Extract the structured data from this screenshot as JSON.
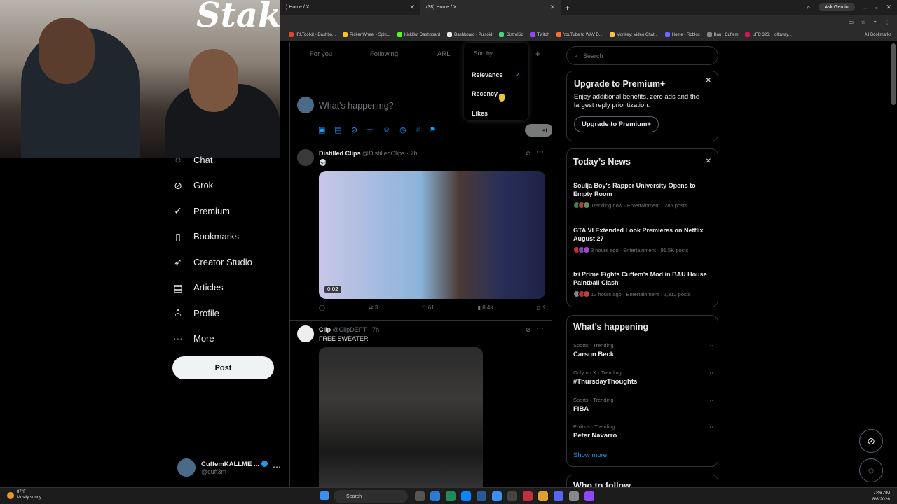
{
  "browser": {
    "tabs": [
      {
        "title": ") Home / X",
        "active": false
      },
      {
        "title": "(38) Home / X",
        "active": true
      }
    ],
    "new_tab": "+",
    "ask_gemini": "Ask Gemini",
    "bookmarks": [
      {
        "label": "IRLToolkit • Dashbo...",
        "color": "#e0452c"
      },
      {
        "label": "Picker Wheel - Spin...",
        "color": "#f2c230"
      },
      {
        "label": "KickBot Dashboard",
        "color": "#53fc18"
      },
      {
        "label": "Dashboard - Pulsoid",
        "color": "#e9e9e9"
      },
      {
        "label": "DistroKid",
        "color": "#3ddc84"
      },
      {
        "label": "Twitch",
        "color": "#9146ff"
      },
      {
        "label": "YouTube to WAV D...",
        "color": "#ff6b2c"
      },
      {
        "label": "Monkey: Video Chat...",
        "color": "#f5c542"
      },
      {
        "label": "Home - Roblox",
        "color": "#6b6bff"
      },
      {
        "label": "Bau | Cuffem",
        "color": "#888888"
      },
      {
        "label": "UFC 326: Holloway...",
        "color": "#d4145a"
      }
    ],
    "all_bookmarks": "All Bookmarks"
  },
  "nav": {
    "items": [
      {
        "label": "Chat",
        "icon": "chat-icon",
        "glyph": "◌"
      },
      {
        "label": "Grok",
        "icon": "grok-icon",
        "glyph": "⊘"
      },
      {
        "label": "Premium",
        "icon": "premium-icon",
        "glyph": "✓"
      },
      {
        "label": "Bookmarks",
        "icon": "bookmark-icon",
        "glyph": "▯"
      },
      {
        "label": "Creator Studio",
        "icon": "rocket-icon",
        "glyph": "➶"
      },
      {
        "label": "Articles",
        "icon": "articles-icon",
        "glyph": "▤"
      },
      {
        "label": "Profile",
        "icon": "profile-icon",
        "glyph": "♙"
      },
      {
        "label": "More",
        "icon": "more-icon",
        "glyph": "⋯"
      }
    ],
    "post_label": "Post",
    "account": {
      "name": "CuffemKALLME ...",
      "handle": "@cuff3m"
    }
  },
  "timeline": {
    "tabs": [
      "For you",
      "Following",
      "ARL"
    ],
    "compose_placeholder": "What's happening?",
    "post_button": "st",
    "sort_menu": {
      "title": "Sort by",
      "options": [
        "Relevance",
        "Recency",
        "Likes"
      ],
      "selected": "Relevance"
    },
    "tweets": [
      {
        "name": "Distilled Clips",
        "handle": "@DistilledClips · 7h",
        "text": "💀",
        "video_time": "0:02",
        "reposts": "3",
        "likes": "61",
        "views": "8.4K"
      },
      {
        "name": "Clip",
        "handle": "@ClipDEPT · 7h",
        "text": "FREE SWEATER"
      }
    ]
  },
  "right": {
    "search_placeholder": "Search",
    "premium": {
      "title": "Upgrade to Premium+",
      "desc": "Enjoy additional benefits, zero ads and the largest reply prioritization.",
      "button": "Upgrade to Premium+"
    },
    "news": {
      "title": "Today’s News",
      "items": [
        {
          "title": "Soulja Boy's Rapper University Opens to Empty Room",
          "meta": "Trending now · Entertainment · 285 posts"
        },
        {
          "title": "GTA VI Extended Look Premieres on Netflix August 27",
          "meta": "3 hours ago · Entertainment · 91.5K posts"
        },
        {
          "title": "Izi Prime Fights Cuffem's Mod in BAU House Paintball Clash",
          "meta": "12 hours ago · Entertainment · 2,312 posts"
        }
      ]
    },
    "happening": {
      "title": "What’s happening",
      "items": [
        {
          "cat": "Sports · Trending",
          "name": "Carson Beck"
        },
        {
          "cat": "Only on X · Trending",
          "name": "#ThursdayThoughts"
        },
        {
          "cat": "Sports · Trending",
          "name": "FIBA"
        },
        {
          "cat": "Politics · Trending",
          "name": "Peter Navarro"
        }
      ],
      "show_more": "Show more"
    },
    "who_to_follow": "Who to follow"
  },
  "taskbar": {
    "weather_temp": "87°F",
    "weather_desc": "Mostly sunny",
    "search": "Search",
    "time": "7:46 AM",
    "date": "8/6/2026"
  }
}
